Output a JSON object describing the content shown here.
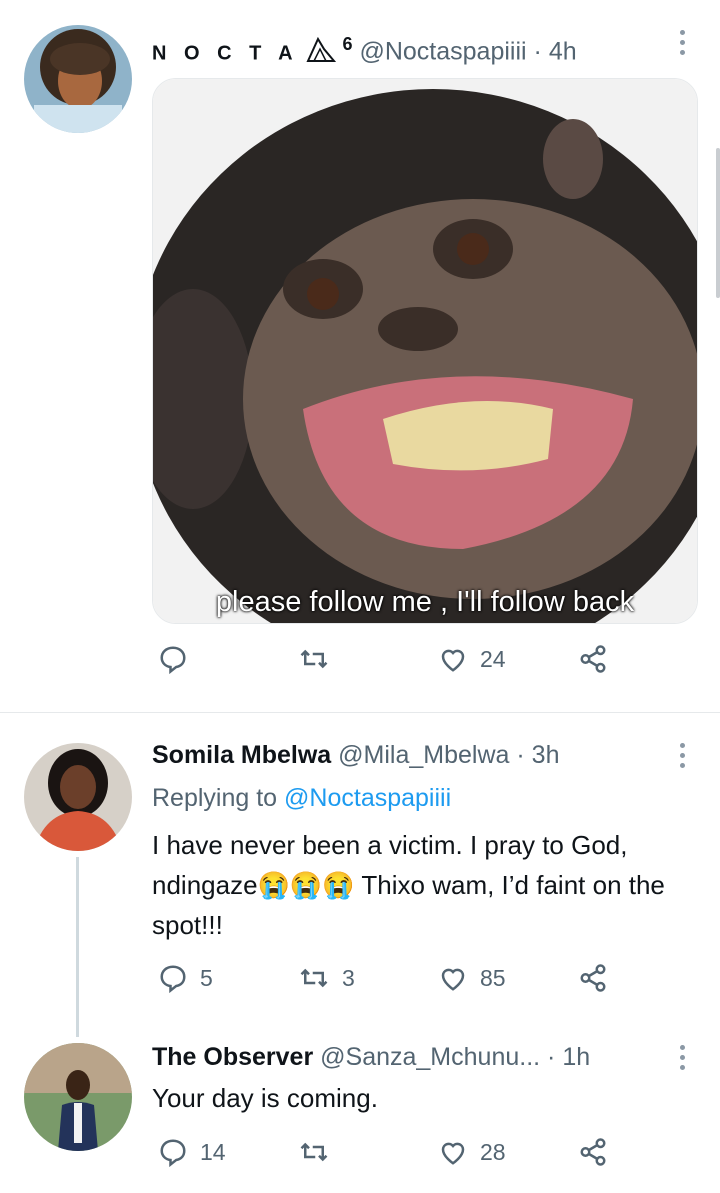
{
  "tweets": [
    {
      "name": "N O C T A",
      "badge": "6",
      "handle": "@Noctaspapiiii",
      "time": "· 4h",
      "media_caption": "please follow me , I'll follow back",
      "reply_count": "",
      "retweet_count": "",
      "like_count": "24"
    },
    {
      "name": "Somila Mbelwa",
      "handle": "@Mila_Mbelwa",
      "time": "· 3h",
      "replying_prefix": "Replying to",
      "replying_handle": "@Noctaspapiiii",
      "text": "I have never been a victim. I pray to God, ndingaze😭😭😭 Thixo wam, I’d faint on the spot!!!",
      "reply_count": "5",
      "retweet_count": "3",
      "like_count": "85"
    },
    {
      "name": "The Observer",
      "handle": "@Sanza_Mchunu...",
      "time": "· 1h",
      "text": "Your day is coming.",
      "reply_count": "14",
      "retweet_count": "",
      "like_count": "28"
    }
  ],
  "icons": [
    "reply-icon",
    "retweet-icon",
    "like-icon",
    "share-icon",
    "more-icon",
    "owl-badge-icon"
  ],
  "colors": {
    "link": "#1d9bf0",
    "secondary_text": "#536471",
    "divider": "#e6e9eb"
  }
}
